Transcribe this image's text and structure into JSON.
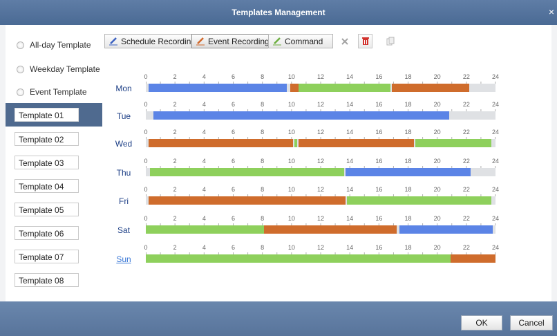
{
  "window": {
    "title": "Templates Management",
    "close_glyph": "×"
  },
  "template_types": [
    {
      "label": "All-day Template"
    },
    {
      "label": "Weekday Template"
    },
    {
      "label": "Event Template"
    }
  ],
  "templates": [
    {
      "label": "Template 01",
      "selected": true
    },
    {
      "label": "Template 02"
    },
    {
      "label": "Template 03"
    },
    {
      "label": "Template 04"
    },
    {
      "label": "Template 05"
    },
    {
      "label": "Template 06"
    },
    {
      "label": "Template 07"
    },
    {
      "label": "Template 08"
    }
  ],
  "toolbar": {
    "schedule_recording": "Schedule Recording",
    "event_recording": "Event Recording",
    "command": "Command"
  },
  "colors": {
    "schedule": "#5b84e6",
    "event": "#cf6c2c",
    "command": "#8ed05c",
    "empty": "#dfe1e4",
    "title_bar": "#4f6e98",
    "pencil_schedule": "#3a5fc0",
    "pencil_event": "#d2682a",
    "pencil_command": "#6cae3e"
  },
  "hour_labels": [
    "0",
    "2",
    "4",
    "6",
    "8",
    "10",
    "12",
    "14",
    "16",
    "18",
    "20",
    "22",
    "24"
  ],
  "days": [
    {
      "name": "Mon",
      "segments": [
        {
          "type": "schedule",
          "start": 0.2,
          "end": 9.7
        },
        {
          "type": "event",
          "start": 9.9,
          "end": 10.5
        },
        {
          "type": "command",
          "start": 10.5,
          "end": 16.8
        },
        {
          "type": "event",
          "start": 16.9,
          "end": 22.2
        }
      ]
    },
    {
      "name": "Tue",
      "segments": [
        {
          "type": "schedule",
          "start": 0.5,
          "end": 20.8
        }
      ]
    },
    {
      "name": "Wed",
      "segments": [
        {
          "type": "event",
          "start": 0.2,
          "end": 10.1
        },
        {
          "type": "command",
          "start": 10.2,
          "end": 10.4
        },
        {
          "type": "event",
          "start": 10.5,
          "end": 18.4
        },
        {
          "type": "command",
          "start": 18.5,
          "end": 23.7
        }
      ]
    },
    {
      "name": "Thu",
      "segments": [
        {
          "type": "command",
          "start": 0.3,
          "end": 13.6
        },
        {
          "type": "schedule",
          "start": 13.7,
          "end": 22.3
        }
      ]
    },
    {
      "name": "Fri",
      "segments": [
        {
          "type": "event",
          "start": 0.2,
          "end": 13.7
        },
        {
          "type": "command",
          "start": 13.8,
          "end": 23.7
        }
      ]
    },
    {
      "name": "Sat",
      "segments": [
        {
          "type": "command",
          "start": 0,
          "end": 8.1
        },
        {
          "type": "event",
          "start": 8.1,
          "end": 17.2
        },
        {
          "type": "schedule",
          "start": 17.4,
          "end": 23.8
        }
      ]
    },
    {
      "name": "Sun",
      "link": true,
      "segments": [
        {
          "type": "command",
          "start": 0,
          "end": 20.9
        },
        {
          "type": "event",
          "start": 20.9,
          "end": 24
        }
      ]
    }
  ],
  "footer": {
    "ok": "OK",
    "cancel": "Cancel"
  }
}
